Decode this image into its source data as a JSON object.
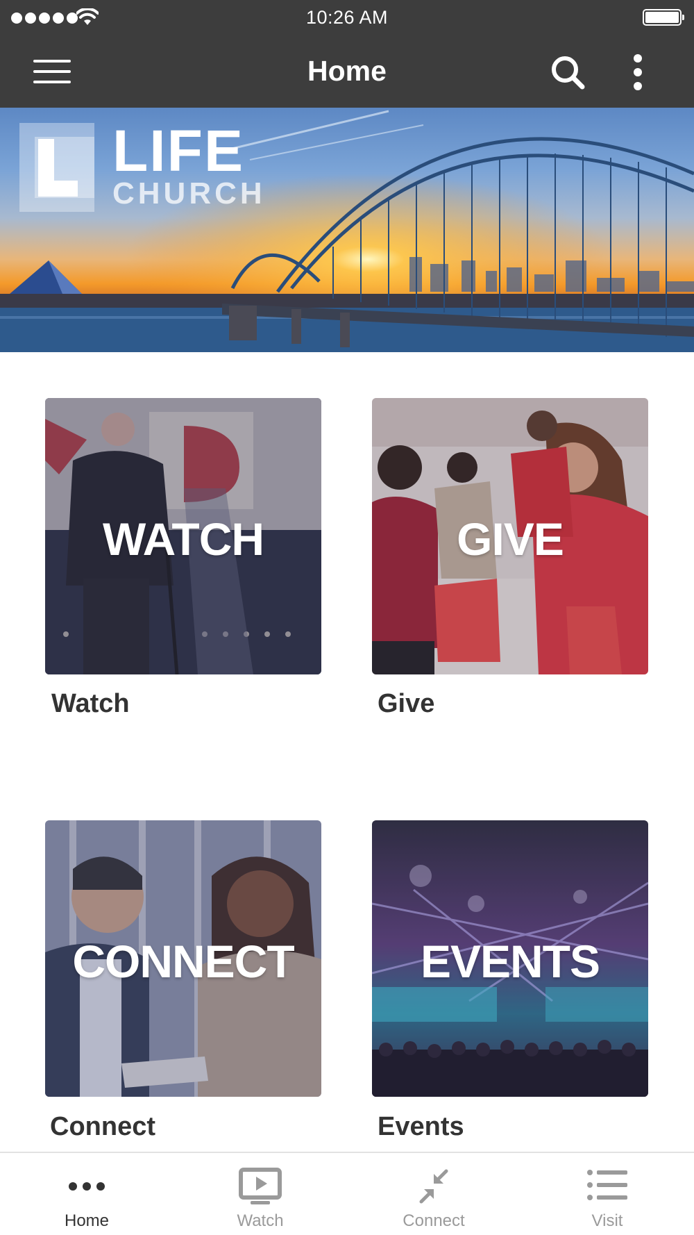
{
  "status_bar": {
    "time": "10:26 AM"
  },
  "nav": {
    "title": "Home"
  },
  "hero": {
    "logo_line1": "LIFE",
    "logo_line2": "CHURCH"
  },
  "tiles": [
    {
      "key": "watch",
      "overlay_text": "WATCH",
      "label": "Watch"
    },
    {
      "key": "give",
      "overlay_text": "GIVE",
      "label": "Give"
    },
    {
      "key": "connect",
      "overlay_text": "CONNECT",
      "label": "Connect"
    },
    {
      "key": "events",
      "overlay_text": "EVENTS",
      "label": "Events"
    }
  ],
  "tab_bar": {
    "tabs": [
      {
        "label": "Home",
        "icon": "ellipsis-icon",
        "active": true
      },
      {
        "label": "Watch",
        "icon": "tv-play-icon",
        "active": false
      },
      {
        "label": "Connect",
        "icon": "compress-arrows-icon",
        "active": false
      },
      {
        "label": "Visit",
        "icon": "list-icon",
        "active": false
      }
    ]
  },
  "colors": {
    "bar_background": "#3d3d3d",
    "tab_active": "#333333",
    "tab_inactive": "#9a9a9a"
  }
}
